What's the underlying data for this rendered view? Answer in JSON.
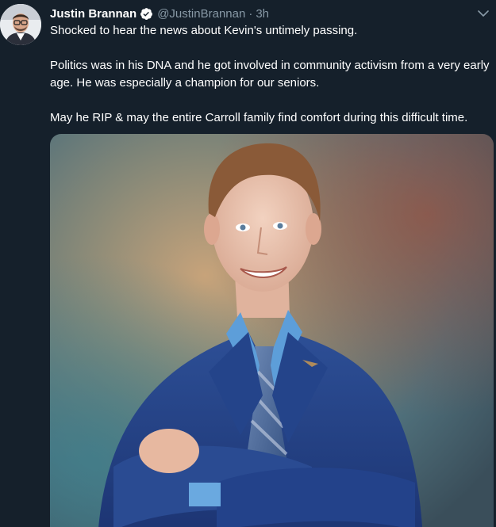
{
  "tweet": {
    "display_name": "Justin Brannan",
    "handle": "@JustinBrannan",
    "separator": "·",
    "time": "3h",
    "paragraphs": [
      "Shocked to hear the news about Kevin's untimely passing.",
      "Politics was in his DNA and he got involved in community activism from a very early age. He was especially a champion for our seniors.",
      "May he RIP & may the entire Carroll family find comfort during this difficult time."
    ],
    "verified_icon": "verified-badge-icon",
    "menu_icon": "chevron-down-icon",
    "photo_description_icon": "portrait-photo"
  },
  "colors": {
    "background": "#15202b",
    "text_primary": "#ffffff",
    "text_secondary": "#8899a6",
    "verified": "#ffffff"
  }
}
